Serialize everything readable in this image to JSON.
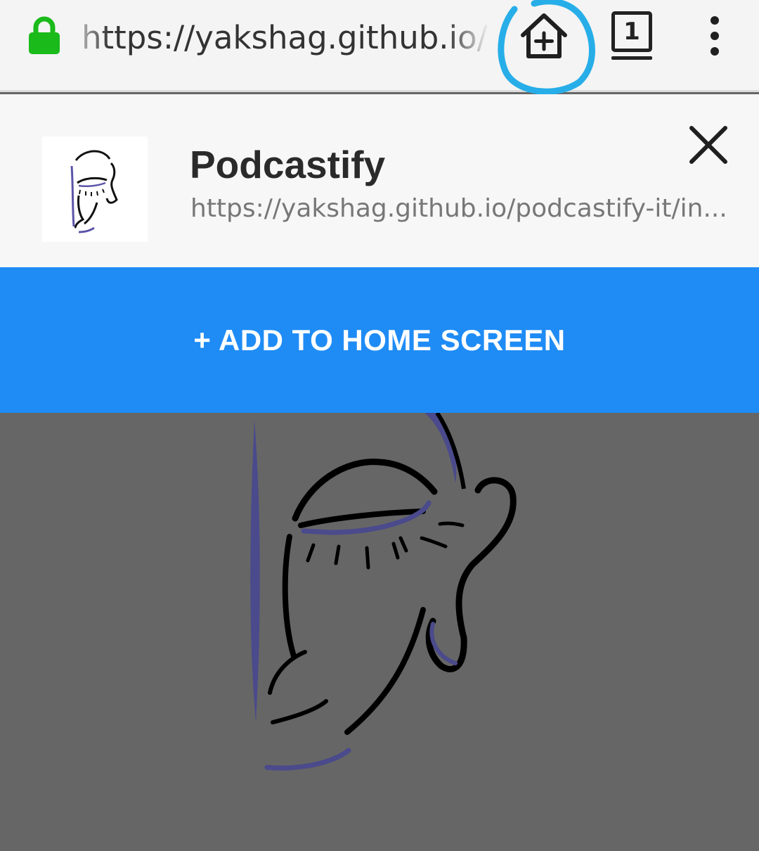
{
  "toolbar": {
    "url_text": "https://yakshag.github.io/podcastify-it/index.html",
    "tab_count": "1",
    "colors": {
      "lock": "#1aba1a",
      "highlight_ring": "#27aee8"
    },
    "icons": [
      "lock-icon",
      "add-to-home-icon",
      "tab-switcher-icon",
      "overflow-menu-icon"
    ]
  },
  "install_banner": {
    "app_name": "Podcastify",
    "app_url": "https://yakshag.github.io/podcastify-it/in...",
    "close_icon": "close-icon",
    "cta_label": "+ ADD TO HOME SCREEN",
    "cta_color": "#1f8cf5"
  },
  "content": {
    "background": "#666666",
    "illustration": "buddha-face-line-art"
  }
}
